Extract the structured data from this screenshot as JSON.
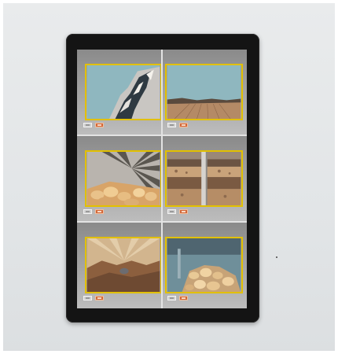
{
  "colors": {
    "bezel": "#141414",
    "tile_border": "#e2c000",
    "divider": "#e3e3e3",
    "alert_button": "#d2683a",
    "view_button": "#cfcfcf"
  },
  "grid": {
    "rows": 3,
    "columns": 2,
    "cells": [
      {
        "id": "cam-1",
        "scene": "rock-face",
        "buttons": [
          "view-icon",
          "alert-icon"
        ]
      },
      {
        "id": "cam-2",
        "scene": "horizon-field",
        "buttons": [
          "view-icon",
          "alert-icon"
        ]
      },
      {
        "id": "cam-3",
        "scene": "rock-pile-rays",
        "buttons": [
          "view-icon",
          "alert-icon"
        ]
      },
      {
        "id": "cam-4",
        "scene": "conveyor-pipe",
        "buttons": [
          "view-icon",
          "alert-icon"
        ]
      },
      {
        "id": "cam-5",
        "scene": "tunnel-dust",
        "buttons": [
          "view-icon",
          "alert-icon"
        ]
      },
      {
        "id": "cam-6",
        "scene": "boulder-pile",
        "buttons": [
          "view-icon",
          "alert-icon"
        ]
      }
    ]
  }
}
